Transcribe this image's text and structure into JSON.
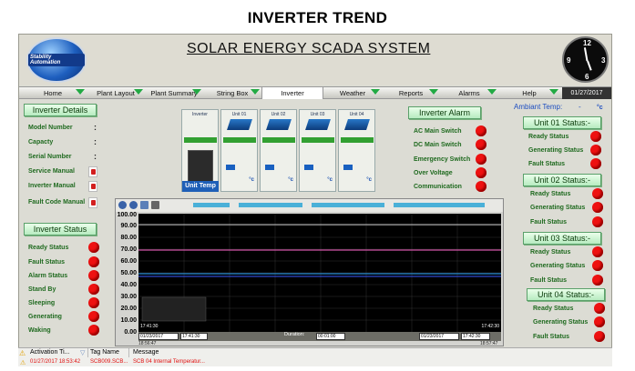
{
  "page_title": "INVERTER TREND",
  "app_title": "SOLAR ENERGY SCADA  SYSTEM",
  "logo_text": "Stability Automation",
  "clock_numbers": {
    "n12": "12",
    "n3": "3",
    "n6": "6",
    "n9": "9"
  },
  "nav": {
    "tabs": [
      "Home",
      "Plant Layout",
      "Plant Summary",
      "String Box",
      "Inverter",
      "Weather",
      "Reports",
      "Alarms",
      "Help"
    ],
    "active": "Inverter",
    "date": "01/27/2017"
  },
  "inverter_details": {
    "title": "Inverter Details",
    "fields": [
      "Model Number",
      "Capacty",
      "Serial Number"
    ],
    "colon": ":",
    "manuals": [
      "Service Manual",
      "Inverter Manual",
      "Fault Code Manual"
    ]
  },
  "inverter_status": {
    "title": "Inverter Status",
    "items": [
      "Ready Status",
      "Fault Status",
      "Alarm Status",
      "Stand By",
      "Sleeping",
      "Generating",
      "Waking"
    ]
  },
  "unit_cards": {
    "inverter": "Inverter",
    "units": [
      "Unit 01",
      "Unit 02",
      "Unit 03",
      "Unit 04"
    ],
    "deg": "°c",
    "unit_temp": "Unit Temp"
  },
  "inverter_alarm": {
    "title": "Inverter Alarm",
    "items": [
      "AC Main Switch",
      "DC Main Switch",
      "Emergency Switch",
      "Over Voltage",
      "Communication"
    ]
  },
  "ambient": {
    "label": "Ambiant Temp:",
    "value": "-",
    "unit": "°c"
  },
  "units_status": [
    {
      "title": "Unit 01 Status:-",
      "items": [
        "Ready Status",
        "Generating Status",
        "Fault Status"
      ]
    },
    {
      "title": "Unit 02 Status:-",
      "items": [
        "Ready Status",
        "Generating Status",
        "Fault Status"
      ]
    },
    {
      "title": "Unit 03 Status:-",
      "items": [
        "Ready Status",
        "Generating Status",
        "Fault Status"
      ]
    },
    {
      "title": "Unit 04 Status:-",
      "items": [
        "Ready Status",
        "Generating Status",
        "Fault Status"
      ]
    }
  ],
  "trend": {
    "y_ticks": [
      "100.00",
      "90.00",
      "80.00",
      "70.00",
      "60.00",
      "50.00",
      "40.00",
      "30.00",
      "20.00",
      "10.00",
      "0.00"
    ],
    "start_time": "17:41:30",
    "end_time": "17:42:30",
    "start_date": "01/23/2017",
    "end_date": "01/23/2017",
    "start_clock": "17:41:30",
    "end_clock": "17:42:30",
    "duration_label": "Duration:",
    "duration": "00:01:00",
    "bottom_left": "18:56:47",
    "bottom_right": "18:57:47"
  },
  "alarm_log": {
    "headers": [
      "Activation Ti...",
      "Tag Name",
      "Message"
    ],
    "row": [
      "01/27/2017 18:53:42",
      "SCB009.SCB...",
      "SCB 04 Internal Temperatur..."
    ]
  },
  "colors": {
    "green_button": "#c6efcc",
    "alarm_red": "#ee1111",
    "nav_green": "#22aa44",
    "plot_bg": "#000000"
  }
}
